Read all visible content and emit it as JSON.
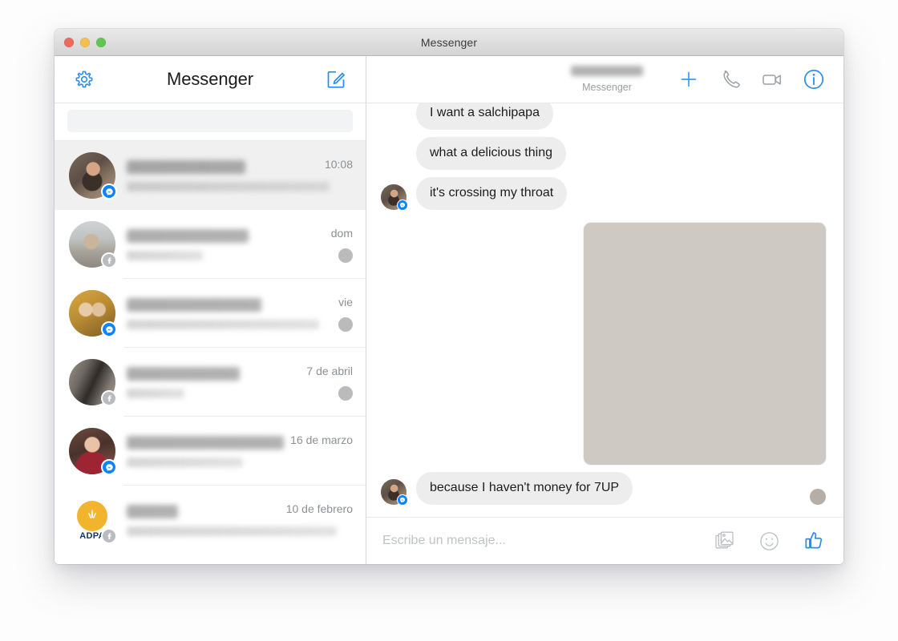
{
  "window": {
    "title": "Messenger",
    "traffic_lights": [
      {
        "name": "close",
        "color": "#ED6A5E"
      },
      {
        "name": "minimize",
        "color": "#F5BF4F"
      },
      {
        "name": "maximize",
        "color": "#61C554"
      }
    ]
  },
  "sidebar": {
    "title": "Messenger",
    "settings_icon": "gear-icon",
    "compose_icon": "compose-pencil-icon",
    "search": {
      "value": "",
      "placeholder": ""
    },
    "conversations": [
      {
        "name_redacted": true,
        "preview_redacted": true,
        "time": "10:08",
        "badge": "messenger",
        "avatar": "art-man-phone",
        "selected": true,
        "receipt": null
      },
      {
        "name_redacted": true,
        "preview_redacted": true,
        "time": "dom",
        "badge": "facebook",
        "avatar": "art-beach",
        "selected": false,
        "receipt": "art-receipt-beach"
      },
      {
        "name_redacted": true,
        "preview_redacted": true,
        "time": "vie",
        "badge": "messenger",
        "avatar": "art-two-women",
        "selected": false,
        "receipt": "art-receipt-gold"
      },
      {
        "name_redacted": true,
        "preview_redacted": true,
        "time": "7 de abril",
        "badge": "facebook",
        "avatar": "art-dancer",
        "selected": false,
        "receipt": "art-receipt-dancer"
      },
      {
        "name_redacted": true,
        "preview_redacted": true,
        "time": "16 de marzo",
        "badge": "messenger",
        "avatar": "art-woman-red",
        "selected": false,
        "receipt": null
      },
      {
        "name_redacted": true,
        "preview_redacted": true,
        "time": "10 de febrero",
        "badge": "facebook",
        "avatar": "adpa",
        "avatar_label": "ADPA",
        "selected": false,
        "receipt": null
      }
    ]
  },
  "chat": {
    "header": {
      "title_redacted": true,
      "subtitle": "Messenger",
      "actions": [
        {
          "name": "add-person-icon",
          "label": "+"
        },
        {
          "name": "phone-call-icon",
          "label": ""
        },
        {
          "name": "video-call-icon",
          "label": ""
        },
        {
          "name": "info-icon",
          "label": "i"
        }
      ]
    },
    "messages": [
      {
        "id": "m1",
        "text": "I want a salchipapa",
        "side": "incoming",
        "clipped": true,
        "avatar": false
      },
      {
        "id": "m2",
        "text": "what a delicious thing",
        "side": "incoming",
        "avatar": false
      },
      {
        "id": "m3",
        "text": "it's crossing my throat",
        "side": "incoming",
        "avatar": true
      },
      {
        "id": "m4",
        "type": "media",
        "media_kind": "gif-video",
        "side": "outgoing"
      },
      {
        "id": "m5",
        "text": "because I haven't money for 7UP",
        "side": "incoming",
        "avatar": true,
        "read_receipt": true
      }
    ]
  },
  "composer": {
    "value": "",
    "placeholder": "Escribe un mensaje...",
    "actions": [
      {
        "name": "photo-attachment-icon"
      },
      {
        "name": "emoji-smiley-icon"
      },
      {
        "name": "thumbs-up-icon"
      }
    ]
  },
  "colors": {
    "accent_blue": "#0A84FF",
    "bubble_gray": "#EDEDED",
    "sidebar_selected": "#F0F0F0",
    "timestamp_gray": "#8C9095",
    "adpa_gold": "#F2B42C",
    "adpa_navy": "#16335E"
  }
}
